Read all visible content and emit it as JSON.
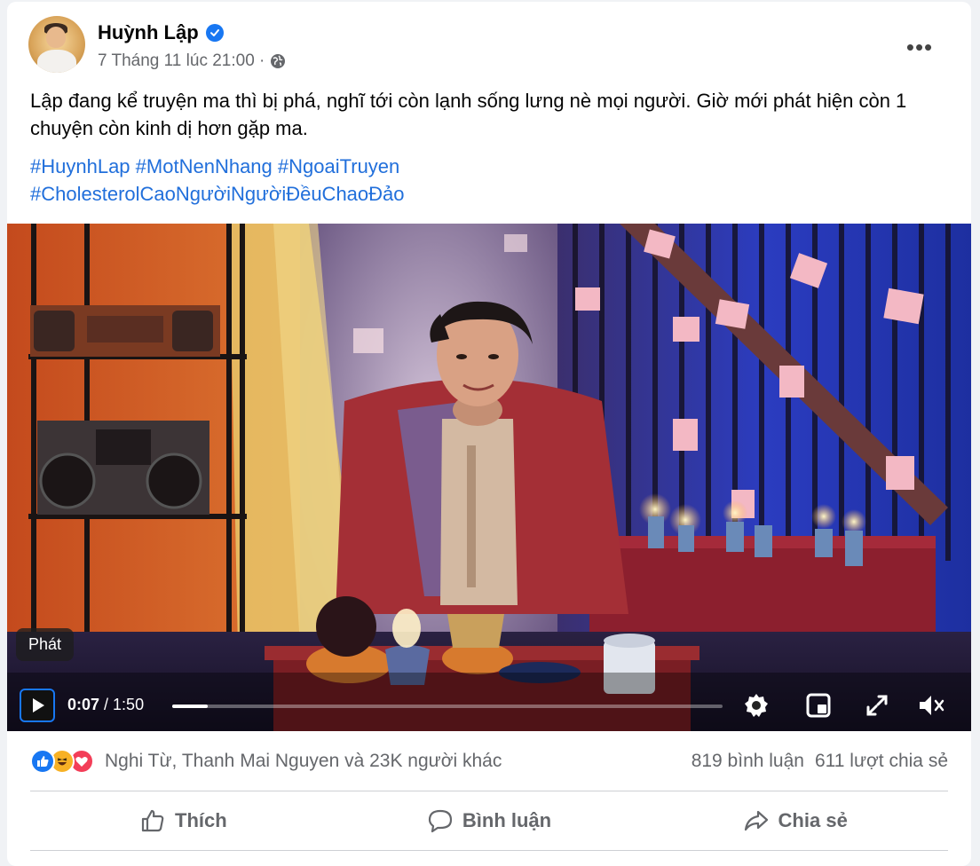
{
  "post": {
    "author": "Huỳnh Lập",
    "timestamp": "7 Tháng 11 lúc 21:00 ·",
    "body": "Lập đang kể truyện ma thì bị phá, nghĩ tới còn lạnh sống lưng nè mọi người. Giờ mới phát hiện còn 1 chuyện còn kinh dị hơn gặp ma.",
    "hashtags": [
      "#HuynhLap",
      "#MotNenNhang",
      "#NgoaiTruyen",
      "#CholesterolCaoNgườiNgườiĐềuChaoĐảo"
    ],
    "more_label": "•••",
    "privacy_icon": "globe-icon"
  },
  "video": {
    "tooltip": "Phát",
    "current_time": "0:07",
    "separator": " / ",
    "duration": "1:50",
    "progress": 0.064,
    "icons": [
      "play-icon",
      "settings-icon",
      "miniplayer-icon",
      "fullscreen-icon",
      "mute-icon"
    ]
  },
  "stats": {
    "reactions": [
      "like",
      "haha",
      "love"
    ],
    "reactors": "Nghi Từ, Thanh Mai Nguyen và 23K người khác",
    "comments": "819 bình luận",
    "shares": "611 lượt chia sẻ"
  },
  "actions": {
    "like": "Thích",
    "comment": "Bình luận",
    "share": "Chia sẻ"
  },
  "colors": {
    "link": "#216fdb",
    "verified": "#1877f2",
    "secondary_text": "#65676b"
  }
}
